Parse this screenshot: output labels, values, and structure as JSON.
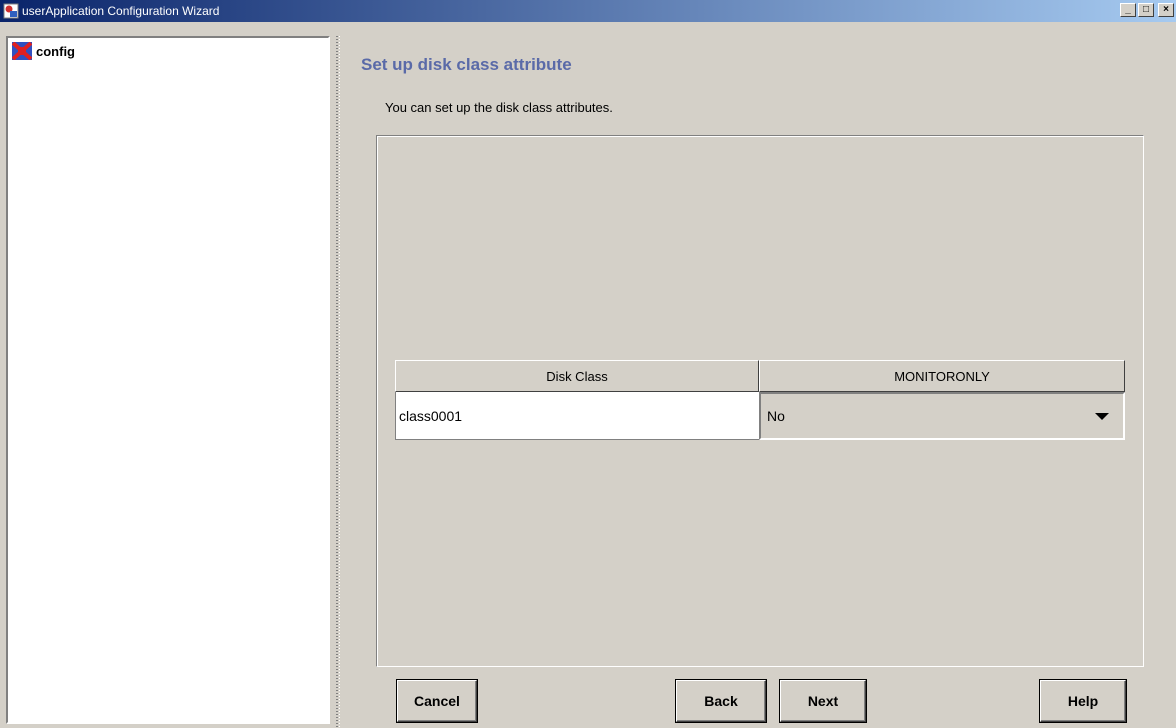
{
  "window": {
    "title": "userApplication Configuration Wizard",
    "icon": "app-icon",
    "controls": {
      "minimize": "_",
      "maximize": "□",
      "close": "×"
    }
  },
  "tree": {
    "items": [
      {
        "label": "config",
        "icon": "config-node-icon"
      }
    ]
  },
  "main": {
    "title": "Set up disk class attribute",
    "description": "You can set up the disk class attributes.",
    "table": {
      "columns": [
        "Disk Class",
        "MONITORONLY"
      ],
      "rows": [
        {
          "disk_class": "class0001",
          "monitoronly": "No"
        }
      ]
    }
  },
  "buttons": {
    "cancel": "Cancel",
    "back": "Back",
    "next": "Next",
    "help": "Help"
  },
  "colors": {
    "title_accent": "#5a6aa8",
    "titlebar_start": "#0a246a",
    "titlebar_end": "#a6caf0",
    "face": "#d4d0c8"
  }
}
